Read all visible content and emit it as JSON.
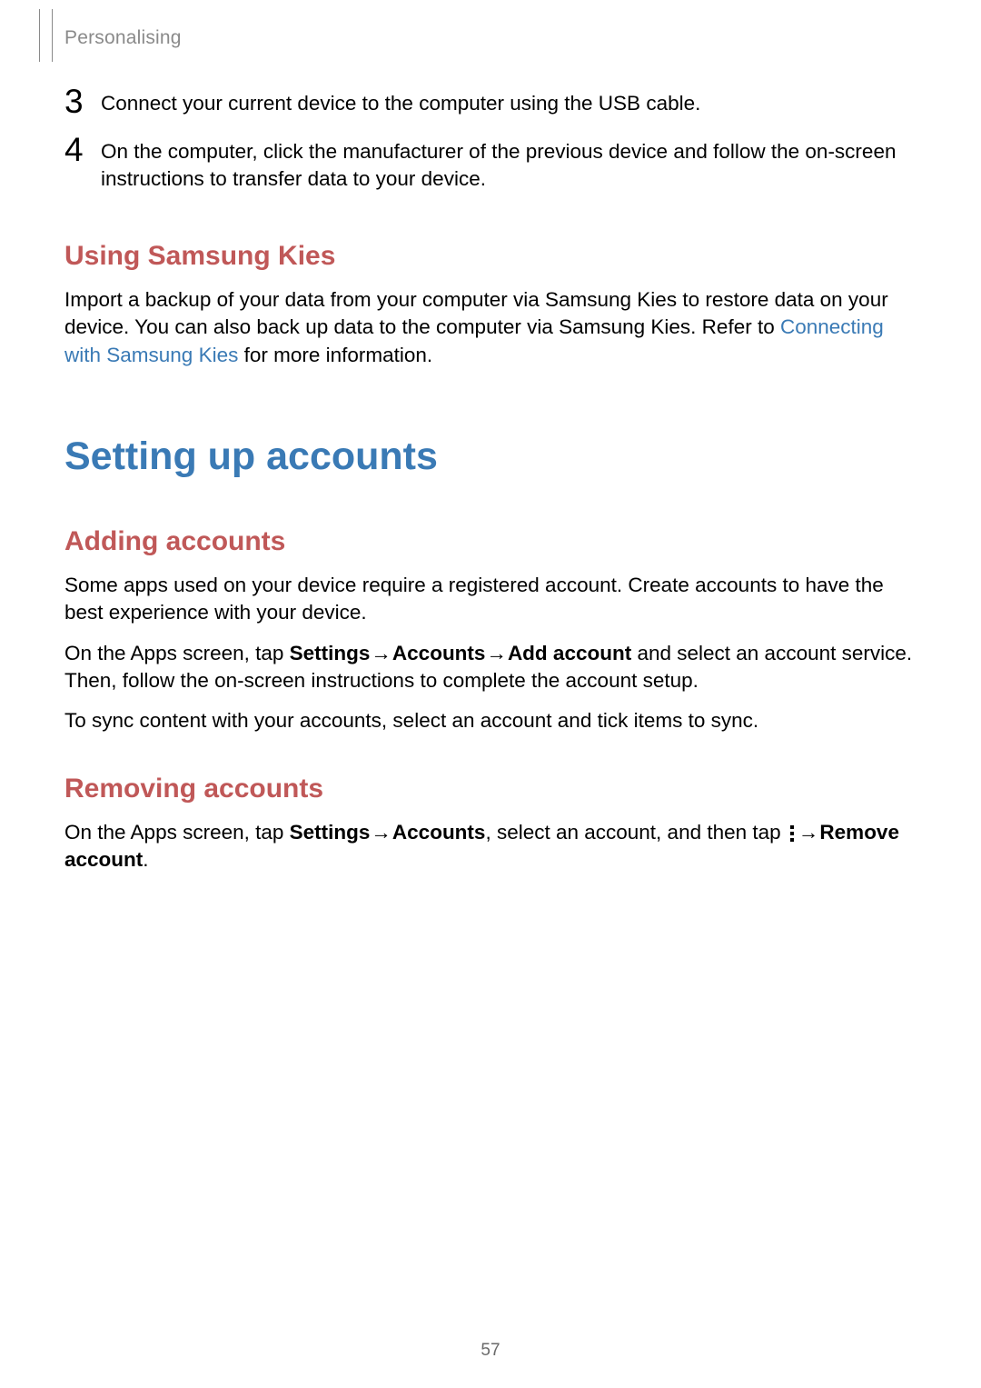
{
  "chapter": "Personalising",
  "steps": [
    {
      "num": "3",
      "text": "Connect your current device to the computer using the USB cable."
    },
    {
      "num": "4",
      "text": "On the computer, click the manufacturer of the previous device and follow the on-screen instructions to transfer data to your device."
    }
  ],
  "kies": {
    "heading": "Using Samsung Kies",
    "para_pre": "Import a backup of your data from your computer via Samsung Kies to restore data on your device. You can also back up data to the computer via Samsung Kies. Refer to ",
    "link": "Connecting with Samsung Kies",
    "para_post": " for more information."
  },
  "accounts": {
    "main_heading": "Setting up accounts",
    "adding": {
      "heading": "Adding accounts",
      "para1": "Some apps used on your device require a registered account. Create accounts to have the best experience with your device.",
      "para2_pre": "On the Apps screen, tap ",
      "para2_b1": "Settings",
      "arrow": " → ",
      "para2_b2": "Accounts",
      "para2_b3": "Add account",
      "para2_post": " and select an account service. Then, follow the on-screen instructions to complete the account setup.",
      "para3": "To sync content with your accounts, select an account and tick items to sync."
    },
    "removing": {
      "heading": "Removing accounts",
      "para_pre": "On the Apps screen, tap ",
      "b1": "Settings",
      "arrow": " → ",
      "b2": "Accounts",
      "mid": ", select an account, and then tap ",
      "b3": "Remove account",
      "end": "."
    }
  },
  "page_number": "57"
}
